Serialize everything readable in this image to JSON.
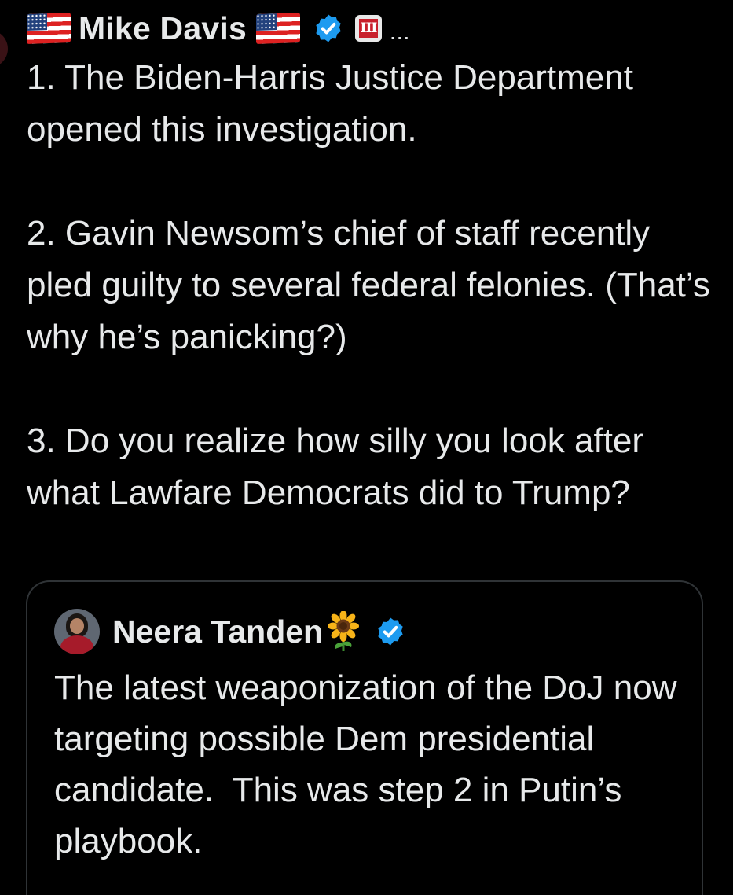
{
  "tweet": {
    "author_name": "Mike Davis",
    "more_label": "...",
    "badge_label": "III",
    "paragraphs": [
      "1. The Biden-Harris Justice Department opened this investigation.",
      "2. Gavin Newsom’s chief of staff recently pled guilty to several federal felonies. (That’s why he’s panicking?)",
      "3. Do you realize how silly you look after what Lawfare Democrats did to Trump?"
    ]
  },
  "quoted_tweet": {
    "author_name": "Neera Tanden",
    "text": "The latest weaponization of the DoJ now targeting possible Dem presidential candidate.  This was step 2 in Putin’s playbook."
  },
  "colors": {
    "background": "#000000",
    "text": "#e7e9ea",
    "verified_badge": "#1d9bf0",
    "card_border": "#2f3336"
  },
  "icons": {
    "flag": "us-flag-icon",
    "verified": "verified-badge-icon",
    "affiliation": "roman-three-badge-icon",
    "sunflower": "sunflower-emoji-icon",
    "more": "more-options-icon"
  }
}
